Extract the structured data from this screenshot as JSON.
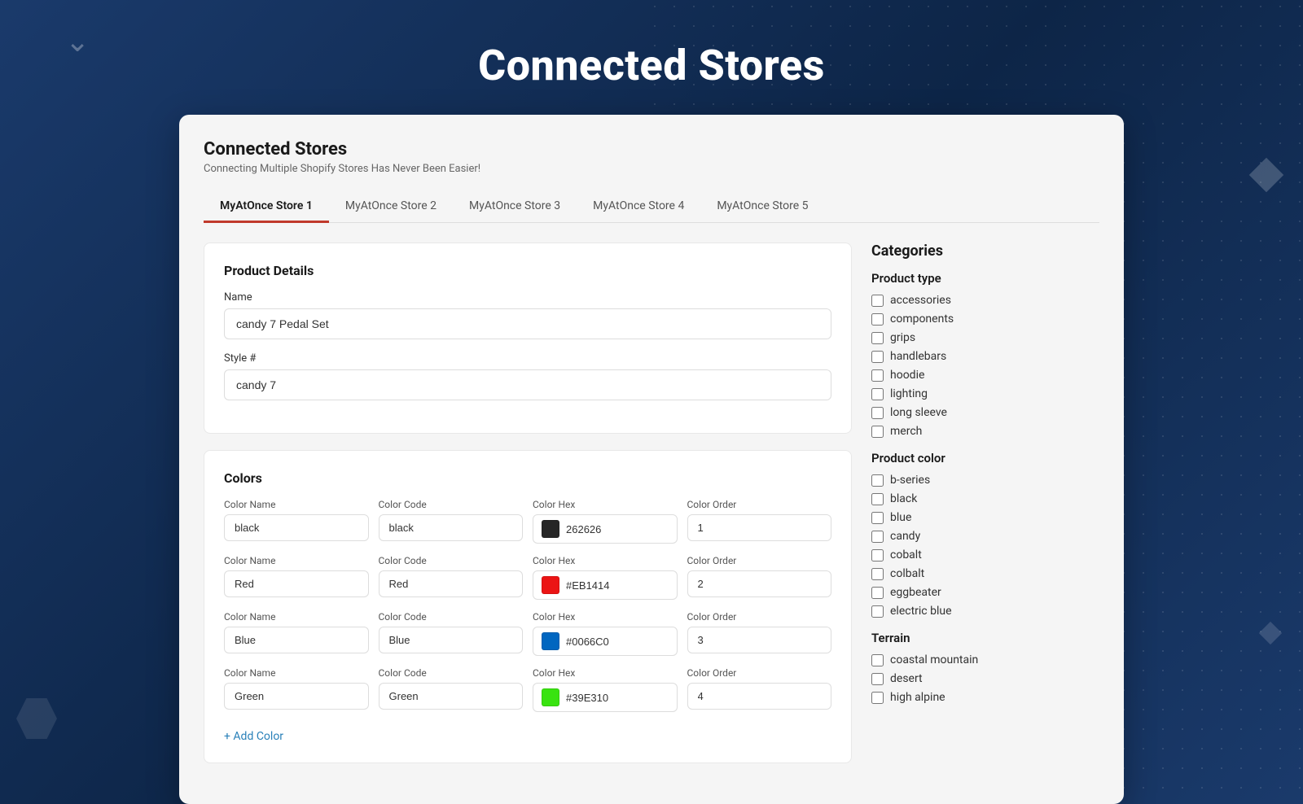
{
  "page": {
    "title": "Connected Stores",
    "bg_color": "#1a3a6b"
  },
  "header": {
    "title": "Connected Stores",
    "subtitle": "Connecting Multiple Shopify Stores Has Never Been Easier!"
  },
  "tabs": [
    {
      "label": "MyAtOnce Store 1",
      "active": true
    },
    {
      "label": "MyAtOnce Store 2",
      "active": false
    },
    {
      "label": "MyAtOnce Store 3",
      "active": false
    },
    {
      "label": "MyAtOnce Store 4",
      "active": false
    },
    {
      "label": "MyAtOnce Store 5",
      "active": false
    }
  ],
  "product_details": {
    "section_title": "Product Details",
    "name_label": "Name",
    "name_value": "candy 7 Pedal Set",
    "style_label": "Style #",
    "style_value": "candy 7"
  },
  "colors": {
    "section_title": "Colors",
    "headers": {
      "color_name": "Color Name",
      "color_code": "Color Code",
      "color_hex": "Color Hex",
      "color_order": "Color Order"
    },
    "rows": [
      {
        "name": "black",
        "code": "black",
        "hex": "262626",
        "hex_color": "#262626",
        "order": "1"
      },
      {
        "name": "Red",
        "code": "Red",
        "hex": "#EB1414",
        "hex_color": "#EB1414",
        "order": "2"
      },
      {
        "name": "Blue",
        "code": "Blue",
        "hex": "#0066C0",
        "hex_color": "#0066C0",
        "order": "3"
      },
      {
        "name": "Green",
        "code": "Green",
        "hex": "#39E310",
        "hex_color": "#39E310",
        "order": "4"
      }
    ],
    "add_color_label": "+ Add Color"
  },
  "categories": {
    "title": "Categories",
    "product_type": {
      "label": "Product type",
      "items": [
        {
          "label": "accessories",
          "checked": false
        },
        {
          "label": "components",
          "checked": false
        },
        {
          "label": "grips",
          "checked": false
        },
        {
          "label": "handlebars",
          "checked": false
        },
        {
          "label": "hoodie",
          "checked": false
        },
        {
          "label": "lighting",
          "checked": false
        },
        {
          "label": "long sleeve",
          "checked": false
        },
        {
          "label": "merch",
          "checked": false
        }
      ]
    },
    "product_color": {
      "label": "Product color",
      "items": [
        {
          "label": "b-series",
          "checked": false
        },
        {
          "label": "black",
          "checked": false
        },
        {
          "label": "blue",
          "checked": false
        },
        {
          "label": "candy",
          "checked": false
        },
        {
          "label": "cobalt",
          "checked": false
        },
        {
          "label": "colbalt",
          "checked": false
        },
        {
          "label": "eggbeater",
          "checked": false
        },
        {
          "label": "electric blue",
          "checked": false
        }
      ]
    },
    "terrain": {
      "label": "Terrain",
      "items": [
        {
          "label": "coastal mountain",
          "checked": false
        },
        {
          "label": "desert",
          "checked": false
        },
        {
          "label": "high alpine",
          "checked": false
        }
      ]
    }
  }
}
